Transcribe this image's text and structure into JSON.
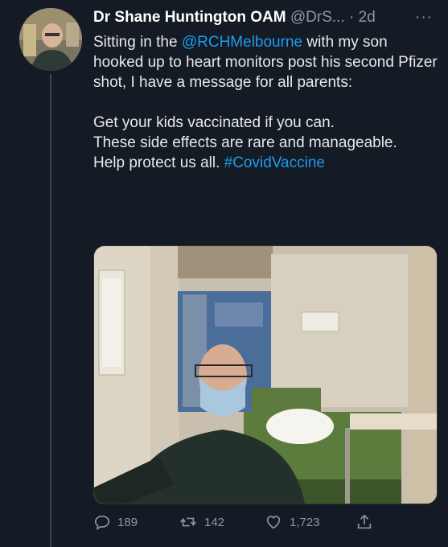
{
  "tweet": {
    "name": "Dr Shane Huntington OAM",
    "handle": "@DrS...",
    "separator": "·",
    "time": "2d",
    "more": "···",
    "mention": "@RCHMelbourne",
    "text_a": "Sitting in the ",
    "text_b": " with my son hooked up to heart monitors post his second Pfizer shot, I have a message for all parents:",
    "text_c": "Get your kids vaccinated if you can.",
    "text_d": "These side effects are rare and manageable.",
    "text_e": "Help protect us all. ",
    "hashtag": "#CovidVaccine"
  },
  "actions": {
    "replies": "189",
    "retweets": "142",
    "likes": "1,723"
  },
  "icons": [
    "reply-icon",
    "retweet-icon",
    "like-icon",
    "share-icon"
  ],
  "colors": {
    "background": "#151b24",
    "link": "#1d9bf0",
    "muted": "#8b98a5"
  }
}
